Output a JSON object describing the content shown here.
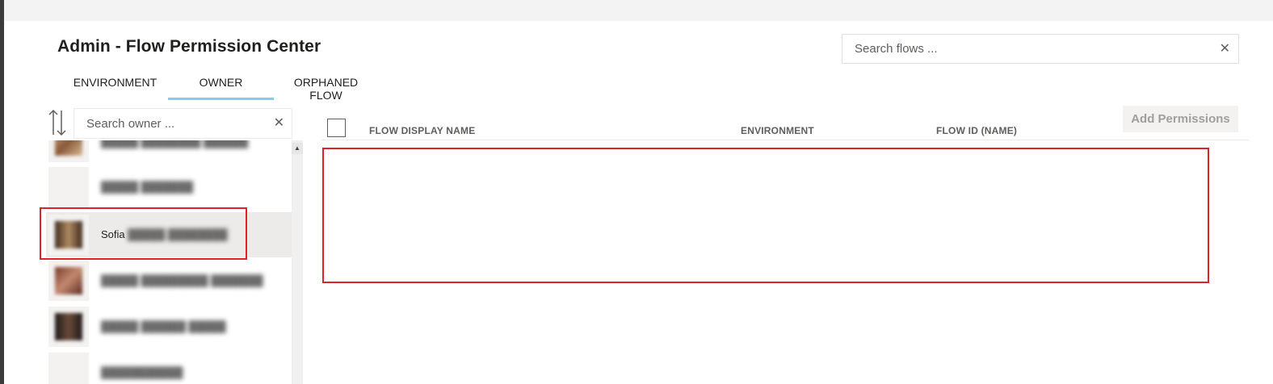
{
  "page": {
    "title": "Admin - Flow Permission Center"
  },
  "search_flows": {
    "placeholder": "Search flows ...",
    "clear_icon": "close-icon"
  },
  "tabs": [
    {
      "label": "ENVIRONMENT",
      "active": false
    },
    {
      "label": "OWNER",
      "active": true
    },
    {
      "label": "ORPHANED FLOW",
      "active": false
    }
  ],
  "owner_panel": {
    "sort_icon": "sort-arrows-icon",
    "search_placeholder": "Search owner ...",
    "clear_icon": "close-icon",
    "selected_owner_name": "Sofia"
  },
  "table": {
    "columns": [
      "FLOW DISPLAY NAME",
      "ENVIRONMENT",
      "FLOW ID (NAME)"
    ],
    "select_all_icon": "checkbox-icon"
  },
  "toolbar": {
    "add_permissions_label": "Add Permissions",
    "disabled": true
  },
  "colors": {
    "tab_indicator": "#7fd0ee",
    "highlight_box": "#e0202b"
  }
}
